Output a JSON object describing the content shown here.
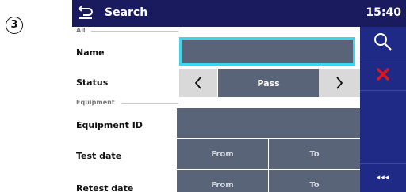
{
  "step_marker": "③",
  "header": {
    "title": "Search",
    "time": "15:40"
  },
  "filters": {
    "all_label": "All",
    "name_label": "Name",
    "name_value": "",
    "status_label": "Status",
    "status_value": "Pass",
    "equipment_label": "Equipment",
    "equipment_id_label": "Equipment ID",
    "equipment_id_value": "",
    "test_date_label": "Test date",
    "test_date_from": "From",
    "test_date_to": "To",
    "retest_date_label": "Retest date",
    "retest_date_from": "From",
    "retest_date_to": "To"
  },
  "sidebar": {
    "more_label": "◂◂◂"
  },
  "icons": {
    "back": "back-arrow-icon",
    "search": "search-icon",
    "clear": "clear-x-icon",
    "prev": "chevron-left-icon",
    "next": "chevron-right-icon"
  },
  "colors": {
    "accent": "#38d8ea",
    "header": "#1a1a5e",
    "sidebar": "#1f2a86",
    "clear": "#e0141e"
  }
}
